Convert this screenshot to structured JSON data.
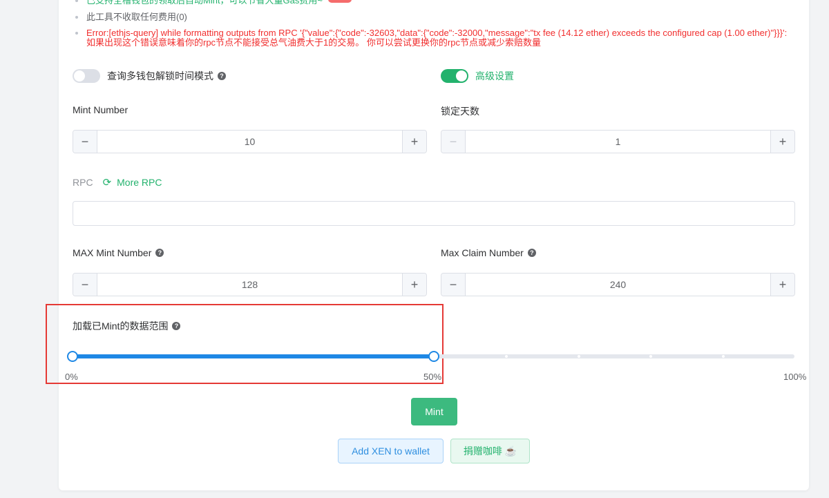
{
  "tips": {
    "green": "已支持全槽钱包的领取后自动Mint，可以节省大量Gas费用~",
    "gray": "此工具不收取任何费用(0)",
    "red": "Error:[ethjs-query] while formatting outputs from RPC '{\"value\":{\"code\":-32603,\"data\":{\"code\":-32000,\"message\":\"tx fee (14.12 ether) exceeds the configured cap (1.00 ether)\"}}}': 如果出现这个错误意味着你的rpc节点不能接受总气油费大于1的交易。 你可以尝试更换你的rpc节点或减少索赔数量"
  },
  "toggles": {
    "multi_wallet": {
      "label": "查询多钱包解锁时间模式",
      "on": false
    },
    "advanced": {
      "label": "高级设置",
      "on": true
    }
  },
  "mint_number": {
    "label": "Mint Number",
    "value": "10"
  },
  "lock_days": {
    "label": "锁定天数",
    "value": "1"
  },
  "rpc": {
    "label": "RPC",
    "more_label": "More RPC",
    "value": "",
    "placeholder": ""
  },
  "max_mint": {
    "label": "MAX Mint Number",
    "value": "128"
  },
  "max_claim": {
    "label": "Max Claim Number",
    "value": "240"
  },
  "range": {
    "title": "加载已Mint的数据范围",
    "start_fraction": 0.0,
    "end_fraction": 0.5,
    "ticks": [
      "0%",
      "50%",
      "100%"
    ]
  },
  "buttons": {
    "mint": "Mint",
    "add_xen": "Add XEN to wallet",
    "coffee": "捐赠咖啡 ☕"
  },
  "icons": {
    "help": "?",
    "minus": "−",
    "plus": "+",
    "refresh": "⟳"
  },
  "colors": {
    "accent_green": "#23b26d",
    "slider_blue": "#1e88e5",
    "error_red": "#f12e2e"
  }
}
